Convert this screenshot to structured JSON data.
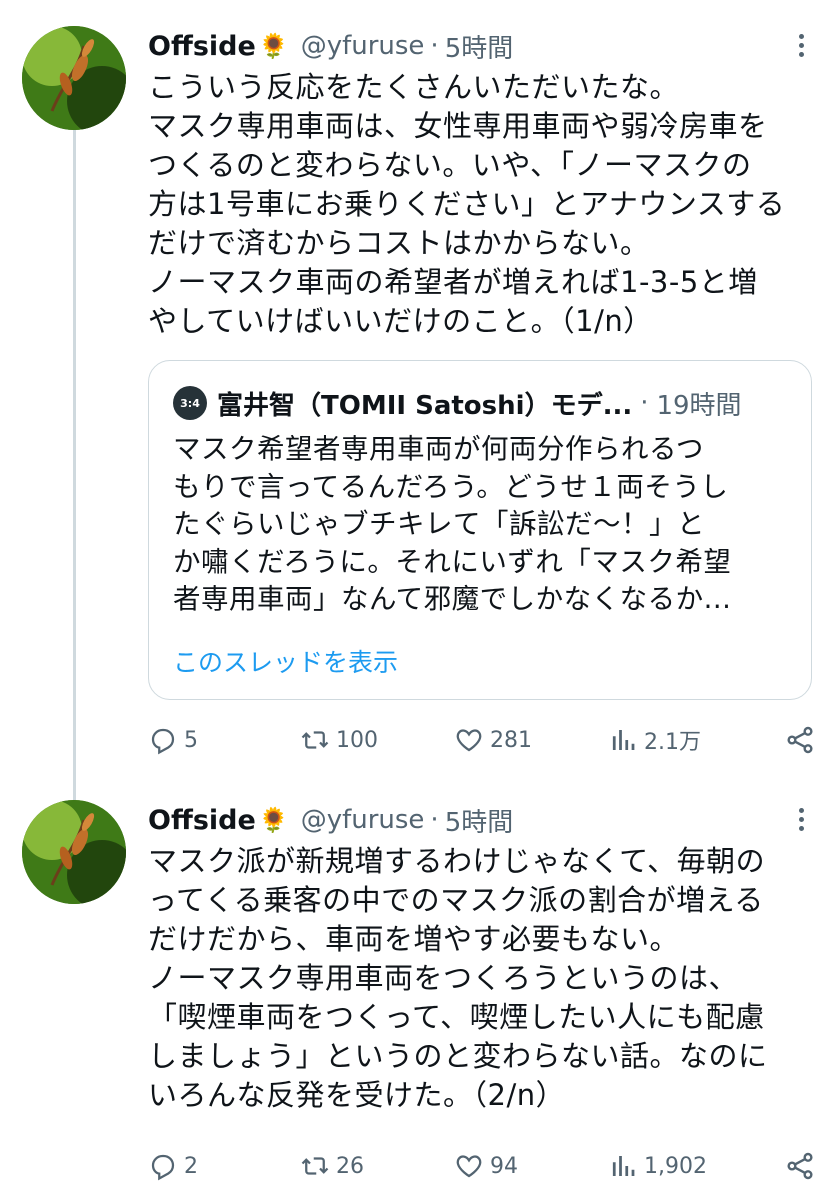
{
  "tweets": [
    {
      "author": {
        "name": "Offside",
        "emoji": "🌻",
        "handle": "@yfuruse"
      },
      "separator": "·",
      "time": "5時間",
      "text": "こういう反応をたくさんいただいたな。\nマスク専用車両は、女性専用車両や弱冷房車を\nつくるのと変わらない。いや、「ノーマスクの\n方は1号車にお乗りください」とアナウンスする\nだけで済むからコストはかからない。\nノーマスク車両の希望者が増えれば1-3-5と増\nやしていけばいいだけのこと。（1/n）",
      "quote": {
        "avatar_text": "3:4",
        "author": "富井智（TOMII Satoshi）モデ...",
        "separator": "·",
        "time": "19時間",
        "text": "マスク希望者専用車両が何両分作られるつ\nもりで言ってるんだろう。どうせ１両そうし\nたぐらいじゃブチキレて「訴訟だ〜！」と\nか嘯くだろうに。それにいずれ「マスク希望\n者専用車両」なんて邪魔でしかなくなるか...",
        "show_thread": "このスレッドを表示"
      },
      "stats": {
        "replies": "5",
        "retweets": "100",
        "likes": "281",
        "views": "2.1万"
      }
    },
    {
      "author": {
        "name": "Offside",
        "emoji": "🌻",
        "handle": "@yfuruse"
      },
      "separator": "·",
      "time": "5時間",
      "text": "マスク派が新規増するわけじゃなくて、毎朝の\nってくる乗客の中でのマスク派の割合が増える\nだけだから、車両を増やす必要もない。\nノーマスク専用車両をつくろうというのは、\n「喫煙車両をつくって、喫煙したい人にも配慮\nしましょう」というのと変わらない話。なのに\nいろんな反発を受けた。（2/n）",
      "stats": {
        "replies": "2",
        "retweets": "26",
        "likes": "94",
        "views": "1,902"
      }
    }
  ],
  "icons": {
    "reply": "reply-icon",
    "retweet": "retweet-icon",
    "like": "heart-icon",
    "views": "views-icon",
    "share": "share-icon",
    "more": "more-icon"
  },
  "colors": {
    "text": "#0f1419",
    "muted": "#536471",
    "link": "#1d9bf0",
    "border": "#cfd9de"
  }
}
